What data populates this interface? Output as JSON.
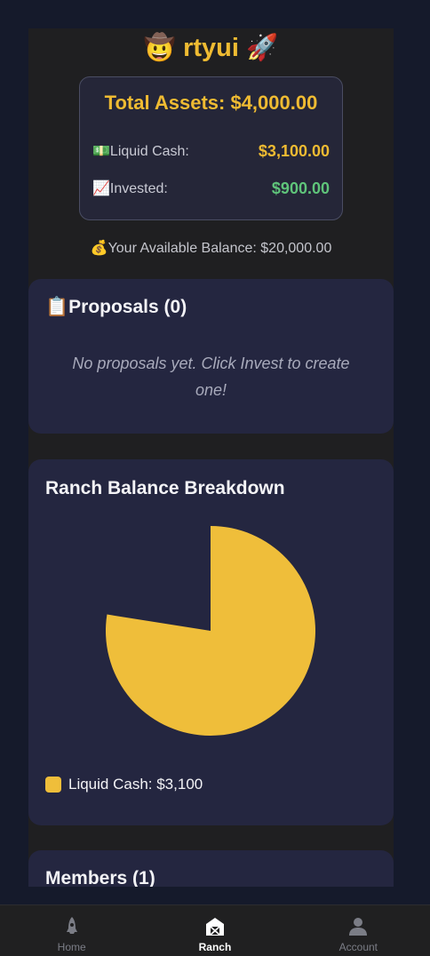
{
  "colors": {
    "accent": "#efbb32",
    "positive": "#5fc47a",
    "card_bg": "#242640",
    "page_bg": "#1f1f21",
    "pie_fill": "#efbe3a"
  },
  "header": {
    "title": "🤠 rtyui 🚀"
  },
  "assets": {
    "total": "Total Assets: $4,000.00",
    "liquid_label": "💵Liquid Cash:",
    "liquid_value": "$3,100.00",
    "invested_label": "📈Invested:",
    "invested_value": "$900.00"
  },
  "available_balance": "💰Your Available Balance: $20,000.00",
  "proposals": {
    "title": "📋Proposals (0)",
    "empty_text": "No proposals yet. Click Invest to create one!"
  },
  "breakdown": {
    "title": "Ranch Balance Breakdown",
    "legend_label": "Liquid Cash: $3,100"
  },
  "chart_data": {
    "type": "pie",
    "categories": [
      "Liquid Cash"
    ],
    "values": [
      3100
    ],
    "total": 4000
  },
  "members": {
    "title": "Members (1)"
  },
  "tabbar": {
    "items": [
      {
        "label": "Home",
        "icon": "rocket-icon"
      },
      {
        "label": "Ranch",
        "icon": "barn-icon"
      },
      {
        "label": "Account",
        "icon": "person-icon"
      }
    ],
    "active": "Ranch"
  }
}
